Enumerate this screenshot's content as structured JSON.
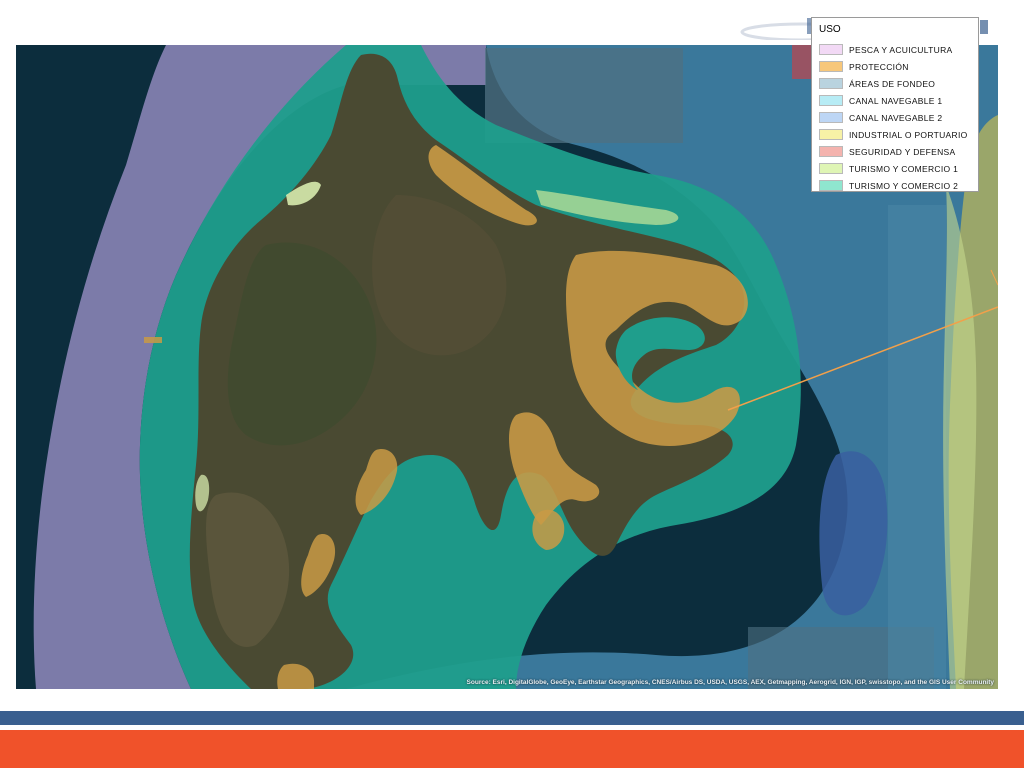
{
  "legend": {
    "title": "USO",
    "items": [
      {
        "label": "PESCA Y ACUICULTURA",
        "color": "#f2d9f5"
      },
      {
        "label": "PROTECCIÓN",
        "color": "#f7c77a"
      },
      {
        "label": "ÁREAS DE FONDEO",
        "color": "#b9d3df"
      },
      {
        "label": "CANAL NAVEGABLE 1",
        "color": "#b7ecf5"
      },
      {
        "label": "CANAL NAVEGABLE 2",
        "color": "#bdd6f5"
      },
      {
        "label": "INDUSTRIAL O PORTUARIO",
        "color": "#f7f2a6"
      },
      {
        "label": "SEGURIDAD Y DEFENSA",
        "color": "#f4b3ae"
      },
      {
        "label": "TURISMO Y COMERCIO 1",
        "color": "#dff5b5"
      },
      {
        "label": "TURISMO Y COMERCIO 2",
        "color": "#8fe6cf"
      }
    ]
  },
  "map": {
    "attribution": "Source: Esri, DigitalGlobe, GeoEye, Earthstar Geographics, CNES/Airbus DS, USDA, USGS, AEX, Getmapping, Aerogrid, IGN, IGP, swisstopo, and the GIS User Community",
    "zones": [
      {
        "name": "open-ocean",
        "color": "#0c2d3d"
      },
      {
        "name": "pesca-acuicultura-zone",
        "color": "#8c86b8"
      },
      {
        "name": "canal-navegable-zone",
        "color": "#3f7fa3"
      },
      {
        "name": "turismo-comercio-2-zone",
        "color": "#1f9e8c"
      },
      {
        "name": "proteccion-zone",
        "color": "#c99a45"
      },
      {
        "name": "island-land",
        "color": "#4a4a32"
      },
      {
        "name": "mainland-coast",
        "color": "#9aa66a"
      }
    ]
  },
  "footer": {
    "band_top_color": "#3a5f8f",
    "band_bottom_color": "#f0522a"
  }
}
